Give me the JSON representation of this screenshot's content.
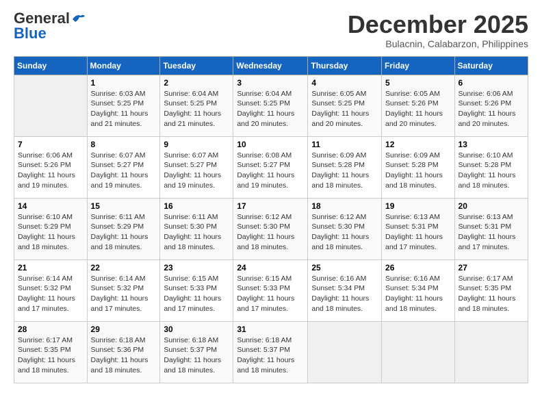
{
  "header": {
    "logo_general": "General",
    "logo_blue": "Blue",
    "month": "December 2025",
    "location": "Bulacnin, Calabarzon, Philippines"
  },
  "weekdays": [
    "Sunday",
    "Monday",
    "Tuesday",
    "Wednesday",
    "Thursday",
    "Friday",
    "Saturday"
  ],
  "weeks": [
    [
      {
        "day": "",
        "sunrise": "",
        "sunset": "",
        "daylight": ""
      },
      {
        "day": "1",
        "sunrise": "Sunrise: 6:03 AM",
        "sunset": "Sunset: 5:25 PM",
        "daylight": "Daylight: 11 hours and 21 minutes."
      },
      {
        "day": "2",
        "sunrise": "Sunrise: 6:04 AM",
        "sunset": "Sunset: 5:25 PM",
        "daylight": "Daylight: 11 hours and 21 minutes."
      },
      {
        "day": "3",
        "sunrise": "Sunrise: 6:04 AM",
        "sunset": "Sunset: 5:25 PM",
        "daylight": "Daylight: 11 hours and 20 minutes."
      },
      {
        "day": "4",
        "sunrise": "Sunrise: 6:05 AM",
        "sunset": "Sunset: 5:25 PM",
        "daylight": "Daylight: 11 hours and 20 minutes."
      },
      {
        "day": "5",
        "sunrise": "Sunrise: 6:05 AM",
        "sunset": "Sunset: 5:26 PM",
        "daylight": "Daylight: 11 hours and 20 minutes."
      },
      {
        "day": "6",
        "sunrise": "Sunrise: 6:06 AM",
        "sunset": "Sunset: 5:26 PM",
        "daylight": "Daylight: 11 hours and 20 minutes."
      }
    ],
    [
      {
        "day": "7",
        "sunrise": "Sunrise: 6:06 AM",
        "sunset": "Sunset: 5:26 PM",
        "daylight": "Daylight: 11 hours and 19 minutes."
      },
      {
        "day": "8",
        "sunrise": "Sunrise: 6:07 AM",
        "sunset": "Sunset: 5:27 PM",
        "daylight": "Daylight: 11 hours and 19 minutes."
      },
      {
        "day": "9",
        "sunrise": "Sunrise: 6:07 AM",
        "sunset": "Sunset: 5:27 PM",
        "daylight": "Daylight: 11 hours and 19 minutes."
      },
      {
        "day": "10",
        "sunrise": "Sunrise: 6:08 AM",
        "sunset": "Sunset: 5:27 PM",
        "daylight": "Daylight: 11 hours and 19 minutes."
      },
      {
        "day": "11",
        "sunrise": "Sunrise: 6:09 AM",
        "sunset": "Sunset: 5:28 PM",
        "daylight": "Daylight: 11 hours and 18 minutes."
      },
      {
        "day": "12",
        "sunrise": "Sunrise: 6:09 AM",
        "sunset": "Sunset: 5:28 PM",
        "daylight": "Daylight: 11 hours and 18 minutes."
      },
      {
        "day": "13",
        "sunrise": "Sunrise: 6:10 AM",
        "sunset": "Sunset: 5:28 PM",
        "daylight": "Daylight: 11 hours and 18 minutes."
      }
    ],
    [
      {
        "day": "14",
        "sunrise": "Sunrise: 6:10 AM",
        "sunset": "Sunset: 5:29 PM",
        "daylight": "Daylight: 11 hours and 18 minutes."
      },
      {
        "day": "15",
        "sunrise": "Sunrise: 6:11 AM",
        "sunset": "Sunset: 5:29 PM",
        "daylight": "Daylight: 11 hours and 18 minutes."
      },
      {
        "day": "16",
        "sunrise": "Sunrise: 6:11 AM",
        "sunset": "Sunset: 5:30 PM",
        "daylight": "Daylight: 11 hours and 18 minutes."
      },
      {
        "day": "17",
        "sunrise": "Sunrise: 6:12 AM",
        "sunset": "Sunset: 5:30 PM",
        "daylight": "Daylight: 11 hours and 18 minutes."
      },
      {
        "day": "18",
        "sunrise": "Sunrise: 6:12 AM",
        "sunset": "Sunset: 5:30 PM",
        "daylight": "Daylight: 11 hours and 18 minutes."
      },
      {
        "day": "19",
        "sunrise": "Sunrise: 6:13 AM",
        "sunset": "Sunset: 5:31 PM",
        "daylight": "Daylight: 11 hours and 17 minutes."
      },
      {
        "day": "20",
        "sunrise": "Sunrise: 6:13 AM",
        "sunset": "Sunset: 5:31 PM",
        "daylight": "Daylight: 11 hours and 17 minutes."
      }
    ],
    [
      {
        "day": "21",
        "sunrise": "Sunrise: 6:14 AM",
        "sunset": "Sunset: 5:32 PM",
        "daylight": "Daylight: 11 hours and 17 minutes."
      },
      {
        "day": "22",
        "sunrise": "Sunrise: 6:14 AM",
        "sunset": "Sunset: 5:32 PM",
        "daylight": "Daylight: 11 hours and 17 minutes."
      },
      {
        "day": "23",
        "sunrise": "Sunrise: 6:15 AM",
        "sunset": "Sunset: 5:33 PM",
        "daylight": "Daylight: 11 hours and 17 minutes."
      },
      {
        "day": "24",
        "sunrise": "Sunrise: 6:15 AM",
        "sunset": "Sunset: 5:33 PM",
        "daylight": "Daylight: 11 hours and 17 minutes."
      },
      {
        "day": "25",
        "sunrise": "Sunrise: 6:16 AM",
        "sunset": "Sunset: 5:34 PM",
        "daylight": "Daylight: 11 hours and 18 minutes."
      },
      {
        "day": "26",
        "sunrise": "Sunrise: 6:16 AM",
        "sunset": "Sunset: 5:34 PM",
        "daylight": "Daylight: 11 hours and 18 minutes."
      },
      {
        "day": "27",
        "sunrise": "Sunrise: 6:17 AM",
        "sunset": "Sunset: 5:35 PM",
        "daylight": "Daylight: 11 hours and 18 minutes."
      }
    ],
    [
      {
        "day": "28",
        "sunrise": "Sunrise: 6:17 AM",
        "sunset": "Sunset: 5:35 PM",
        "daylight": "Daylight: 11 hours and 18 minutes."
      },
      {
        "day": "29",
        "sunrise": "Sunrise: 6:18 AM",
        "sunset": "Sunset: 5:36 PM",
        "daylight": "Daylight: 11 hours and 18 minutes."
      },
      {
        "day": "30",
        "sunrise": "Sunrise: 6:18 AM",
        "sunset": "Sunset: 5:37 PM",
        "daylight": "Daylight: 11 hours and 18 minutes."
      },
      {
        "day": "31",
        "sunrise": "Sunrise: 6:18 AM",
        "sunset": "Sunset: 5:37 PM",
        "daylight": "Daylight: 11 hours and 18 minutes."
      },
      {
        "day": "",
        "sunrise": "",
        "sunset": "",
        "daylight": ""
      },
      {
        "day": "",
        "sunrise": "",
        "sunset": "",
        "daylight": ""
      },
      {
        "day": "",
        "sunrise": "",
        "sunset": "",
        "daylight": ""
      }
    ]
  ]
}
